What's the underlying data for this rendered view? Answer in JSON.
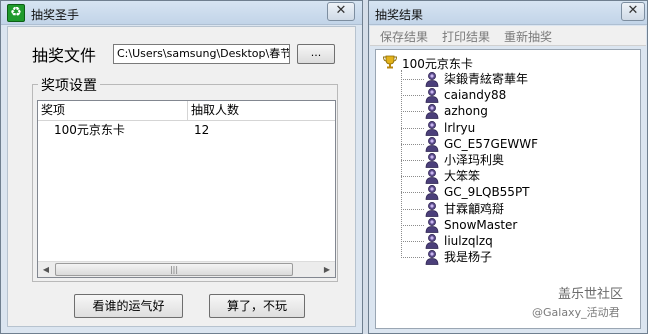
{
  "left_window": {
    "title": "抽奖圣手",
    "icon": "app-logo-icon",
    "close_glyph": "✕",
    "file_label": "抽奖文件",
    "file_path": "C:\\Users\\samsung\\Desktop\\春节活",
    "browse_label": "...",
    "prize_group_caption": "奖项设置",
    "table": {
      "headers": [
        "奖项",
        "抽取人数"
      ],
      "rows": [
        {
          "prize": "100元京东卡",
          "count": "12"
        }
      ]
    },
    "scroll_thumb_grip": "|||",
    "buttons": {
      "draw_label": "看谁的运气好",
      "quit_label": "算了，不玩"
    }
  },
  "right_window": {
    "title": "抽奖结果",
    "close_glyph": "✕",
    "menu": [
      "保存结果",
      "打印结果",
      "重新抽奖"
    ],
    "tree": {
      "root_label": "100元京东卡",
      "root_icon": "trophy-icon",
      "winner_icon": "person-icon",
      "winners": [
        "柒鍛青絃寄華年",
        "caiandy88",
        "azhong",
        "lrlryu",
        "GC_E57GEWWF",
        "小泽玛利奥",
        "大笨笨",
        "GC_9LQB55PT",
        "甘霖龥鸡搿",
        "SnowMaster",
        "liulzqlzq",
        "我是杨子"
      ]
    }
  },
  "watermark": {
    "line1": "盖乐世社区",
    "line2": "@Galaxy_活动君"
  },
  "colors": {
    "desktop": "#d5dee9",
    "app_icon_green": "#1f9a2c",
    "disabled_menu_text": "#7a7a7a"
  }
}
